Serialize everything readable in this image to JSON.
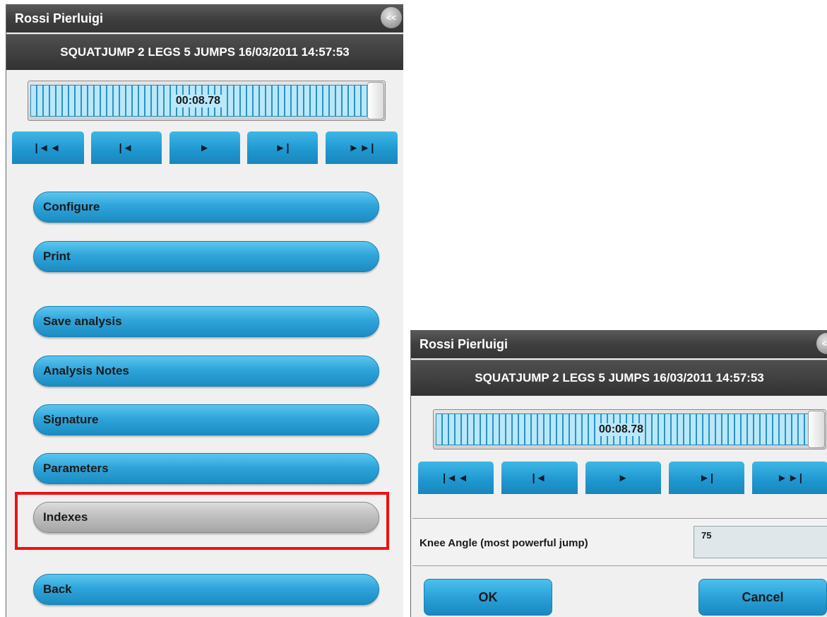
{
  "left_panel": {
    "title": "Rossi Pierluigi",
    "collapse_label": "<<",
    "session": "SQUATJUMP 2 LEGS 5 JUMPS 16/03/2011 14:57:53",
    "timeline": {
      "time": "00:08.78",
      "progress": 1.0
    },
    "transport": [
      "|◄◄",
      "|◄",
      "►",
      "►|",
      "►►|"
    ],
    "menu": {
      "configure": "Configure",
      "print": "Print",
      "save_analysis": "Save analysis",
      "analysis_notes": "Analysis Notes",
      "signature": "Signature",
      "parameters": "Parameters",
      "indexes": "Indexes",
      "back": "Back"
    },
    "highlighted_item": "Indexes",
    "highlight_color": "#ee1111"
  },
  "right_panel": {
    "title": "Rossi Pierluigi",
    "collapse_label": "<<",
    "session": "SQUATJUMP 2 LEGS 5 JUMPS 16/03/2011 14:57:53",
    "timeline": {
      "time": "00:08.78",
      "progress": 1.0
    },
    "transport": [
      "|◄◄",
      "|◄",
      "►",
      "►|",
      "►►|"
    ],
    "field": {
      "label": "Knee Angle (most powerful jump)",
      "value": "75"
    },
    "ok_label": "OK",
    "cancel_label": "Cancel"
  },
  "colors": {
    "button_blue": "#2fa5db",
    "header_dark": "#3f3f3f",
    "highlight_red": "#ee1111"
  }
}
